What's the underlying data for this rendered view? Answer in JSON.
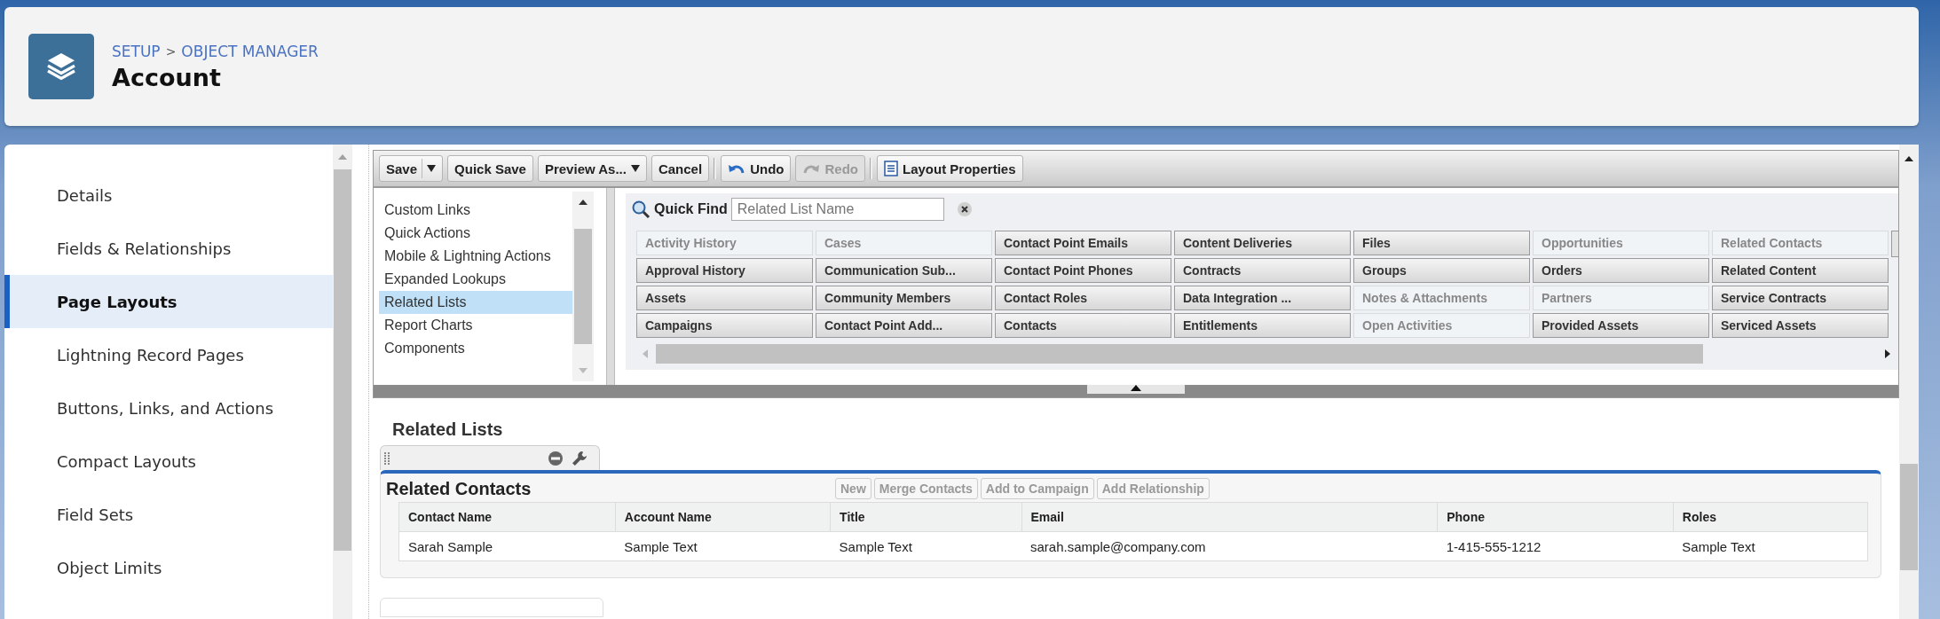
{
  "header": {
    "breadcrumb": [
      {
        "label": "SETUP"
      },
      {
        "label": "OBJECT MANAGER"
      }
    ],
    "separator": ">",
    "title": "Account"
  },
  "sidebar": {
    "items": [
      {
        "label": "Details",
        "selected": false
      },
      {
        "label": "Fields & Relationships",
        "selected": false
      },
      {
        "label": "Page Layouts",
        "selected": true
      },
      {
        "label": "Lightning Record Pages",
        "selected": false
      },
      {
        "label": "Buttons, Links, and Actions",
        "selected": false
      },
      {
        "label": "Compact Layouts",
        "selected": false
      },
      {
        "label": "Field Sets",
        "selected": false
      },
      {
        "label": "Object Limits",
        "selected": false
      }
    ]
  },
  "toolbar": {
    "buttons": [
      {
        "kind": "split",
        "label": "Save",
        "disabled": false
      },
      {
        "kind": "plain",
        "label": "Quick Save",
        "disabled": false
      },
      {
        "kind": "menu",
        "label": "Preview As...",
        "disabled": false
      },
      {
        "kind": "plain",
        "label": "Cancel",
        "disabled": false
      },
      {
        "kind": "separator"
      },
      {
        "kind": "undo",
        "label": "Undo",
        "disabled": false
      },
      {
        "kind": "redo",
        "label": "Redo",
        "disabled": true
      },
      {
        "kind": "separator"
      },
      {
        "kind": "properties",
        "label": "Layout Properties",
        "disabled": false
      }
    ]
  },
  "palette": {
    "categories": [
      {
        "label": "Custom Links",
        "selected": false
      },
      {
        "label": "Quick Actions",
        "selected": false
      },
      {
        "label": "Mobile & Lightning Actions",
        "selected": false
      },
      {
        "label": "Expanded Lookups",
        "selected": false
      },
      {
        "label": "Related Lists",
        "selected": true
      },
      {
        "label": "Report Charts",
        "selected": false
      },
      {
        "label": "Components",
        "selected": false
      }
    ],
    "quick_find": {
      "label": "Quick Find",
      "placeholder": "Related List Name"
    },
    "items": [
      {
        "label": "Activity History",
        "used": true
      },
      {
        "label": "Approval History",
        "used": false
      },
      {
        "label": "Assets",
        "used": false
      },
      {
        "label": "Campaigns",
        "used": false
      },
      {
        "label": "Cases",
        "used": true
      },
      {
        "label": "Communication Sub...",
        "used": false
      },
      {
        "label": "Community Members",
        "used": false
      },
      {
        "label": "Contact Point Add...",
        "used": false
      },
      {
        "label": "Contact Point Emails",
        "used": false
      },
      {
        "label": "Contact Point Phones",
        "used": false
      },
      {
        "label": "Contact Roles",
        "used": false
      },
      {
        "label": "Contacts",
        "used": false
      },
      {
        "label": "Content Deliveries",
        "used": false
      },
      {
        "label": "Contracts",
        "used": false
      },
      {
        "label": "Data Integration ...",
        "used": false
      },
      {
        "label": "Entitlements",
        "used": false
      },
      {
        "label": "Files",
        "used": false
      },
      {
        "label": "Groups",
        "used": false
      },
      {
        "label": "Notes & Attachments",
        "used": true
      },
      {
        "label": "Open Activities",
        "used": true
      },
      {
        "label": "Opportunities",
        "used": true
      },
      {
        "label": "Orders",
        "used": false
      },
      {
        "label": "Partners",
        "used": true
      },
      {
        "label": "Provided Assets",
        "used": false
      },
      {
        "label": "Related Contacts",
        "used": true
      },
      {
        "label": "Related Content",
        "used": false
      },
      {
        "label": "Service Contracts",
        "used": false
      },
      {
        "label": "Serviced Assets",
        "used": false
      }
    ]
  },
  "related_lists": {
    "heading": "Related Lists",
    "lists": [
      {
        "title": "Related Contacts",
        "buttons": [
          {
            "label": "New",
            "disabled": true
          },
          {
            "label": "Merge Contacts",
            "disabled": true
          },
          {
            "label": "Add to Campaign",
            "disabled": true
          },
          {
            "label": "Add Relationship",
            "disabled": true
          }
        ],
        "columns": [
          "Contact Name",
          "Account Name",
          "Title",
          "Email",
          "Phone",
          "Roles"
        ],
        "rows": [
          [
            "Sarah Sample",
            "Sample Text",
            "Sample Text",
            "sarah.sample@company.com",
            "1-415-555-1212",
            "Sample Text"
          ]
        ]
      }
    ]
  }
}
